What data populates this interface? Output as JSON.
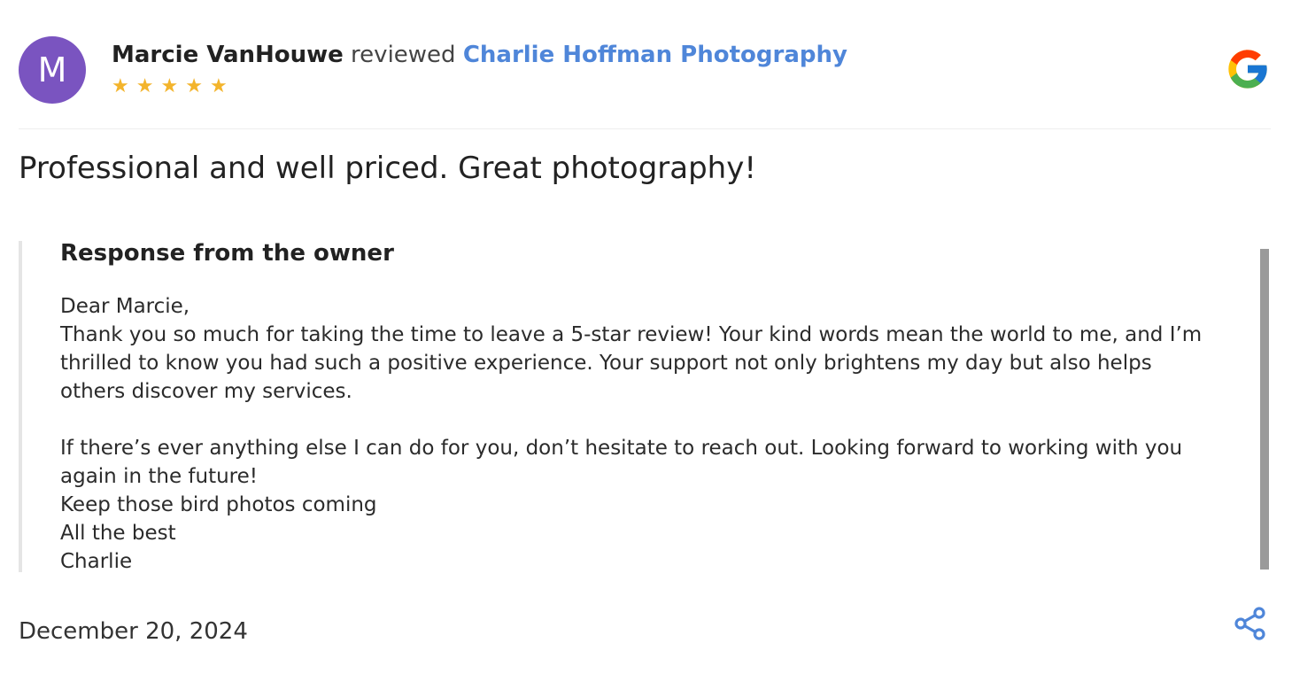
{
  "review": {
    "avatar_initial": "M",
    "reviewer_name": "Marcie VanHouwe",
    "reviewed_word": " reviewed ",
    "business_name": "Charlie Hoffman Photography",
    "rating": 5,
    "stars": [
      "★",
      "★",
      "★",
      "★",
      "★"
    ],
    "text": "Professional and well priced. Great photography!",
    "date": "December 20, 2024"
  },
  "owner_response": {
    "heading": "Response from the owner",
    "lines": [
      "Dear Marcie,",
      "Thank you so much for taking the time to leave a 5-star review! Your kind words mean the world to me, and I’m",
      "thrilled to know you had such a positive experience. Your support not only brightens my day but also helps",
      "others discover my services.",
      "",
      "If there’s ever anything else I can do for you, don’t hesitate to reach out. Looking forward to working with you",
      "again in the future!",
      "Keep those bird photos coming",
      "All the best",
      "Charlie"
    ]
  },
  "icons": {
    "source_logo": "google-icon",
    "share": "share-icon"
  },
  "colors": {
    "avatar_bg": "#7a54c0",
    "link": "#4f86d9",
    "star": "#f3b42c",
    "share": "#4f86d9"
  }
}
